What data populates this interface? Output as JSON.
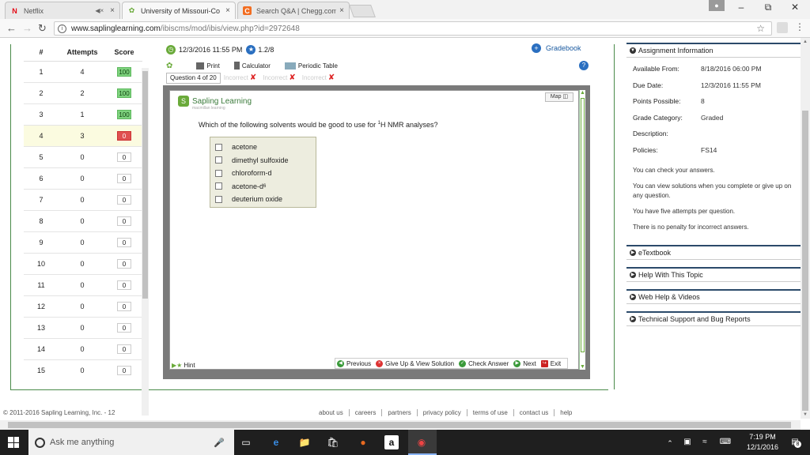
{
  "browser": {
    "tabs": [
      {
        "title": "Netflix",
        "icon": "netflix-icon"
      },
      {
        "title": "University of Missouri-Co",
        "icon": "sapling-leaf-icon"
      },
      {
        "title": "Search Q&A | Chegg.com",
        "icon": "chegg-icon"
      }
    ],
    "url_host": "www.saplinglearning.com",
    "url_path": "/ibiscms/mod/ibis/view.php?id=2972648"
  },
  "attempts_table": {
    "headers": {
      "num": "#",
      "attempts": "Attempts",
      "score": "Score"
    },
    "rows": [
      {
        "num": "1",
        "attempts": "4",
        "score": "100",
        "status": "green"
      },
      {
        "num": "2",
        "attempts": "2",
        "score": "100",
        "status": "green"
      },
      {
        "num": "3",
        "attempts": "1",
        "score": "100",
        "status": "green"
      },
      {
        "num": "4",
        "attempts": "3",
        "score": "0",
        "status": "red"
      },
      {
        "num": "5",
        "attempts": "0",
        "score": "0",
        "status": "none"
      },
      {
        "num": "6",
        "attempts": "0",
        "score": "0",
        "status": "none"
      },
      {
        "num": "7",
        "attempts": "0",
        "score": "0",
        "status": "none"
      },
      {
        "num": "8",
        "attempts": "0",
        "score": "0",
        "status": "none"
      },
      {
        "num": "9",
        "attempts": "0",
        "score": "0",
        "status": "none"
      },
      {
        "num": "10",
        "attempts": "0",
        "score": "0",
        "status": "none"
      },
      {
        "num": "11",
        "attempts": "0",
        "score": "0",
        "status": "none"
      },
      {
        "num": "12",
        "attempts": "0",
        "score": "0",
        "status": "none"
      },
      {
        "num": "13",
        "attempts": "0",
        "score": "0",
        "status": "none"
      },
      {
        "num": "14",
        "attempts": "0",
        "score": "0",
        "status": "none"
      },
      {
        "num": "15",
        "attempts": "0",
        "score": "0",
        "status": "none"
      }
    ]
  },
  "question_header": {
    "due": "12/3/2016 11:55 PM",
    "points": "1.2/8",
    "gradebook": "Gradebook"
  },
  "toolbar": {
    "print": "Print",
    "calculator": "Calculator",
    "periodic_table": "Periodic Table"
  },
  "question_tabs": {
    "current": "Question 4 of 20",
    "attempts": [
      "Incorrect",
      "Incorrect",
      "Incorrect"
    ]
  },
  "question": {
    "brand": "Sapling Learning",
    "brand_sub": "macmillan learning",
    "map_label": "Map",
    "text_before": "Which of the following solvents would be good to use for ",
    "text_sup": "1",
    "text_after": "H NMR analyses?",
    "choices": [
      {
        "label": "acetone",
        "sub": ""
      },
      {
        "label": "dimethyl sulfoxide",
        "sub": ""
      },
      {
        "label": "chloroform-d",
        "sub": ""
      },
      {
        "label": "acetone-d",
        "sub": "6"
      },
      {
        "label": "deuterium oxide",
        "sub": ""
      }
    ],
    "hint": "Hint",
    "actions": {
      "previous": "Previous",
      "give_up": "Give Up & View Solution",
      "check": "Check Answer",
      "next": "Next",
      "exit": "Exit"
    }
  },
  "assignment_info": {
    "title": "Assignment Information",
    "rows": [
      {
        "k": "Available From:",
        "v": "8/18/2016 06:00 PM"
      },
      {
        "k": "Due Date:",
        "v": "12/3/2016 11:55 PM"
      },
      {
        "k": "Points Possible:",
        "v": "8"
      },
      {
        "k": "Grade Category:",
        "v": "Graded"
      },
      {
        "k": "Description:",
        "v": ""
      },
      {
        "k": "Policies:",
        "v": "FS14"
      }
    ],
    "notes": [
      "You can check your answers.",
      "You can view solutions when you complete or give up on any question.",
      "You have five attempts per question.",
      "There is no penalty for incorrect answers."
    ]
  },
  "side_sections": [
    "eTextbook",
    "Help With This Topic",
    "Web Help & Videos",
    "Technical Support and Bug Reports"
  ],
  "footer": {
    "copyright": "© 2011-2016 Sapling Learning, Inc. - 12",
    "links": [
      "about us",
      "careers",
      "partners",
      "privacy policy",
      "terms of use",
      "contact us",
      "help"
    ]
  },
  "taskbar": {
    "search_placeholder": "Ask me anything",
    "time": "7:19 PM",
    "date": "12/1/2016",
    "notification_count": "8"
  },
  "colors": {
    "score_green": "#7ed27e",
    "score_red": "#e05050",
    "brand_green": "#6aaa3a",
    "link_blue": "#1a5aa0",
    "section_border": "#2b4a6a"
  }
}
